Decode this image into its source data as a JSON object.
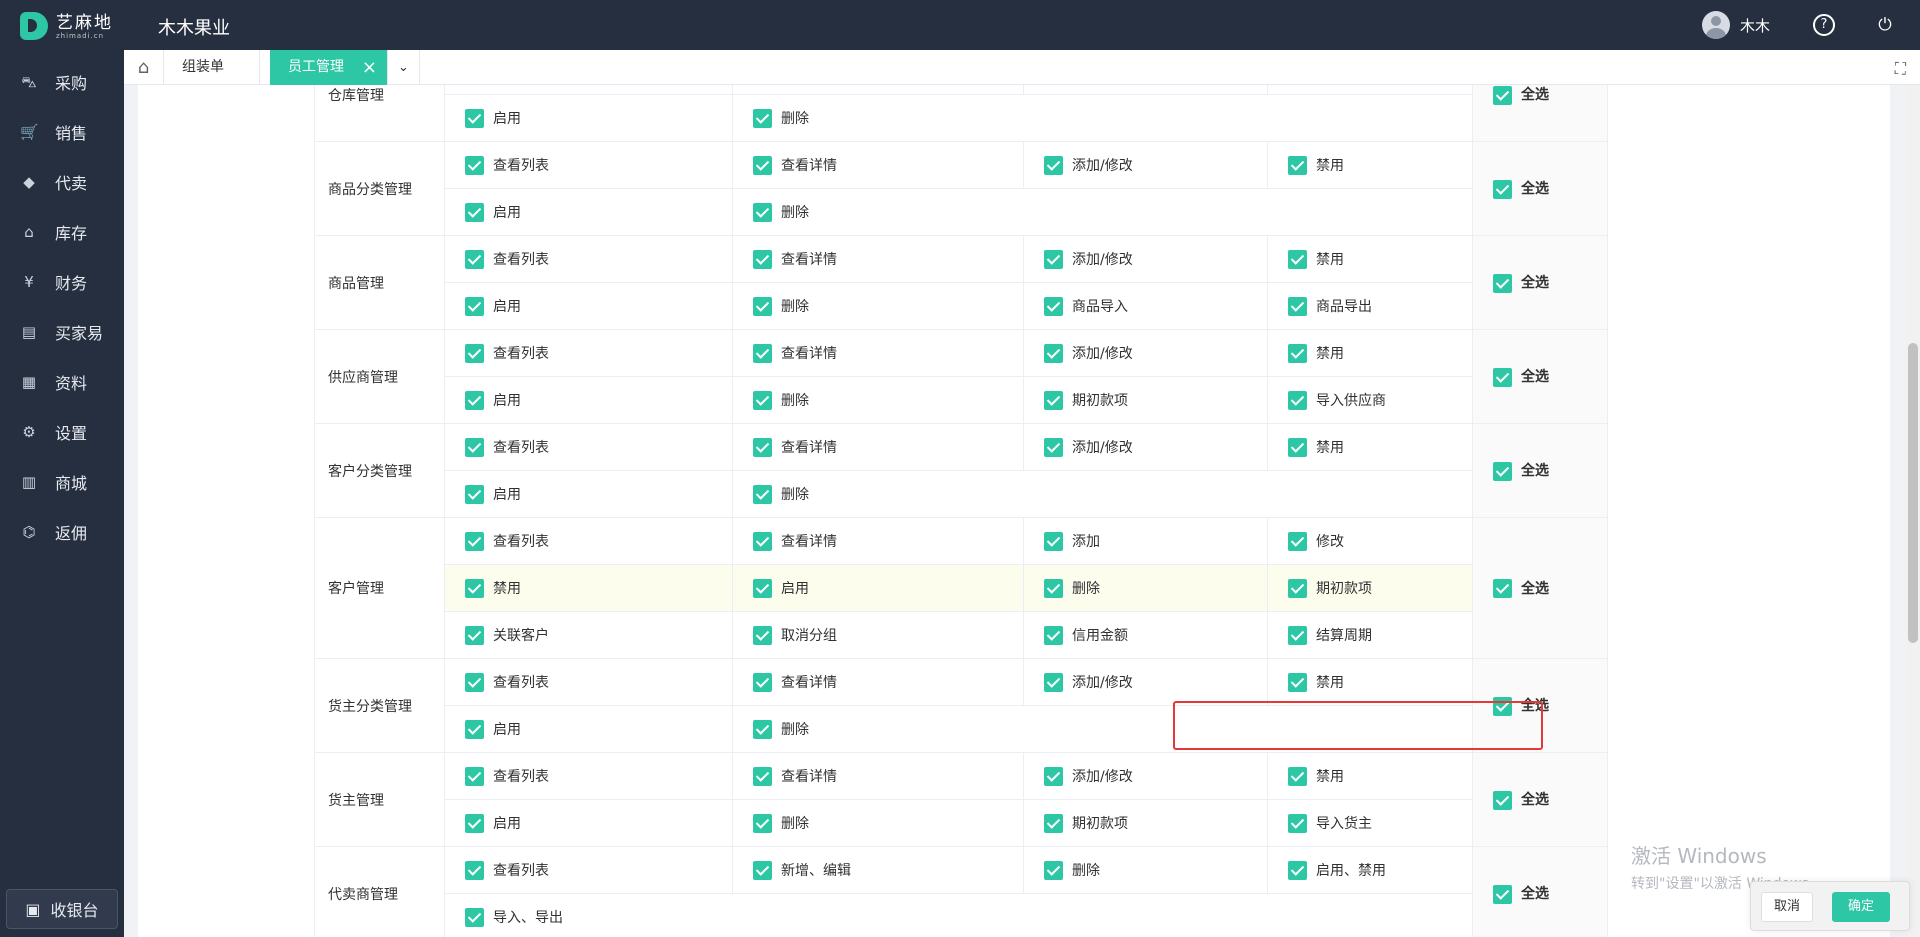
{
  "header": {
    "logo_text": "艺麻地",
    "logo_sub": "zhimadi.cn",
    "company": "木木果业",
    "user_name": "木木"
  },
  "sidebar": {
    "items": [
      {
        "label": "采购",
        "icon": "basket-icon"
      },
      {
        "label": "销售",
        "icon": "cart-icon"
      },
      {
        "label": "代卖",
        "icon": "tag-icon"
      },
      {
        "label": "库存",
        "icon": "warehouse-icon"
      },
      {
        "label": "财务",
        "icon": "yuan-icon"
      },
      {
        "label": "买家易",
        "icon": "store-icon"
      },
      {
        "label": "资料",
        "icon": "printer-icon"
      },
      {
        "label": "设置",
        "icon": "gear-icon"
      },
      {
        "label": "商城",
        "icon": "shop-icon"
      },
      {
        "label": "返佣",
        "icon": "rebate-icon"
      }
    ],
    "cashier": "收银台"
  },
  "tabs": [
    {
      "label": "组装单",
      "active": false
    },
    {
      "label": "员工管理",
      "active": true
    }
  ],
  "select_all_label": "全选",
  "rows": [
    {
      "module": "仓库管理",
      "lines": [
        [
          "",
          "",
          "",
          ""
        ],
        [
          "启用",
          "删除"
        ]
      ]
    },
    {
      "module": "商品分类管理",
      "lines": [
        [
          "查看列表",
          "查看详情",
          "添加/修改",
          "禁用"
        ],
        [
          "启用",
          "删除"
        ]
      ]
    },
    {
      "module": "商品管理",
      "lines": [
        [
          "查看列表",
          "查看详情",
          "添加/修改",
          "禁用"
        ],
        [
          "启用",
          "删除",
          "商品导入",
          "商品导出"
        ]
      ]
    },
    {
      "module": "供应商管理",
      "lines": [
        [
          "查看列表",
          "查看详情",
          "添加/修改",
          "禁用"
        ],
        [
          "启用",
          "删除",
          "期初款项",
          "导入供应商"
        ]
      ]
    },
    {
      "module": "客户分类管理",
      "lines": [
        [
          "查看列表",
          "查看详情",
          "添加/修改",
          "禁用"
        ],
        [
          "启用",
          "删除"
        ]
      ]
    },
    {
      "module": "客户管理",
      "lines": [
        [
          "查看列表",
          "查看详情",
          "添加",
          "修改"
        ],
        [
          "禁用",
          "启用",
          "删除",
          "期初款项"
        ],
        [
          "关联客户",
          "取消分组",
          "信用金额",
          "结算周期"
        ]
      ]
    },
    {
      "module": "货主分类管理",
      "lines": [
        [
          "查看列表",
          "查看详情",
          "添加/修改",
          "禁用"
        ],
        [
          "启用",
          "删除"
        ]
      ]
    },
    {
      "module": "货主管理",
      "lines": [
        [
          "查看列表",
          "查看详情",
          "添加/修改",
          "禁用"
        ],
        [
          "启用",
          "删除",
          "期初款项",
          "导入货主"
        ]
      ]
    },
    {
      "module": "代卖商管理",
      "lines": [
        [
          "查看列表",
          "新增、编辑",
          "删除",
          "启用、禁用"
        ],
        [
          "导入、导出"
        ]
      ]
    }
  ],
  "watermark": {
    "line1": "激活 Windows",
    "line2": "转到\"设置\"以激活 Windows。"
  },
  "buttons": {
    "cancel": "取消",
    "ok": "确定"
  },
  "colors": {
    "accent": "#2ec7a6",
    "sidebar": "#262f3f",
    "highlight": "#e53935"
  }
}
